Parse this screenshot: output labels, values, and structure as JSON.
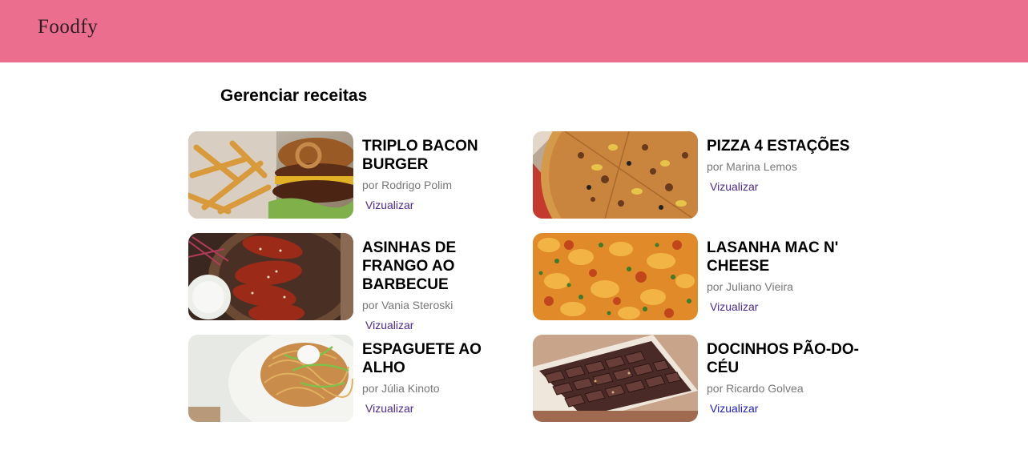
{
  "app": {
    "logo": "Foodfy"
  },
  "main": {
    "title": "Gerenciar receitas"
  },
  "recipes": [
    {
      "title": "TRIPLO BACON BURGER",
      "author": "por Rodrigo Polim",
      "link": "Vizualizar",
      "image": "burger-and-fries-photo"
    },
    {
      "title": "PIZZA 4 ESTAÇÕES",
      "author": "por Marina Lemos",
      "link": "Vizualizar",
      "image": "pizza-photo"
    },
    {
      "title": "ASINHAS DE FRANGO AO BARBECUE",
      "author": "por Vania Steroski",
      "link": "Vizualizar",
      "image": "bbq-chicken-wings-photo"
    },
    {
      "title": "LASANHA MAC N' CHEESE",
      "author": "por Juliano Vieira",
      "link": "Vizualizar",
      "image": "mac-and-cheese-lasagna-photo"
    },
    {
      "title": "ESPAGUETE AO ALHO",
      "author": "por Júlia Kinoto",
      "link": "Vizualizar",
      "image": "garlic-spaghetti-photo"
    },
    {
      "title": "DOCINHOS PÃO-DO-CÉU",
      "author": "por Ricardo Golvea",
      "link": "Vizualizar",
      "image": "chocolate-box-photo"
    }
  ],
  "colors": {
    "header": "#ec6e8f",
    "link": "#4b2a8c",
    "author": "#777777"
  }
}
